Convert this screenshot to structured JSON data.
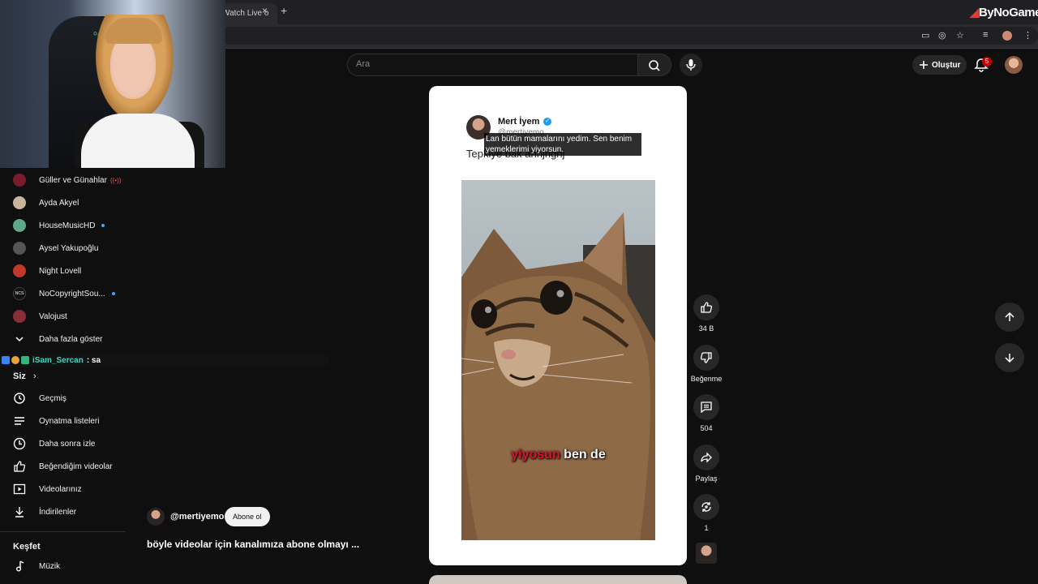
{
  "browser": {
    "tab_title": "Watch Live o",
    "brand": "ByNoGame",
    "tab_close": "×",
    "new_tab": "+"
  },
  "header": {
    "search_placeholder": "Ara",
    "create_label": "Oluştur",
    "notification_count": "5"
  },
  "sidebar": {
    "subscriptions": [
      {
        "name": "Güller ve Günahlar",
        "live": true,
        "color": "#7a1c2c"
      },
      {
        "name": "Ayda Akyel",
        "live": false,
        "color": "#c9b59a"
      },
      {
        "name": "HouseMusicHD",
        "live": true,
        "color": "#5fa88a"
      },
      {
        "name": "Aysel Yakupoğlu",
        "live": false,
        "color": "#555555"
      },
      {
        "name": "Night Lovell",
        "live": false,
        "color": "#c0392b"
      },
      {
        "name": "NoCopyrightSou...",
        "live": true,
        "color": "#111111"
      },
      {
        "name": "Valojust",
        "live": false,
        "color": "#8a2d35"
      }
    ],
    "show_more": "Daha fazla göster",
    "you_heading": "Siz",
    "you_items": [
      "Geçmiş",
      "Oynatma listeleri",
      "Daha sonra izle",
      "Beğendiğim videolar",
      "Videolarınız",
      "İndirilenler"
    ],
    "explore_heading": "Keşfet",
    "explore_items": [
      "Müzik"
    ]
  },
  "chat": {
    "user": "iSam_Sercan",
    "message": ": sa"
  },
  "short": {
    "tweet_author": "Mert İyem",
    "tweet_handle": "@mertiyemo",
    "tweet_text": "Tepkiye bak ahhjhghj",
    "caption": "Lan bütün mamalarını yedim. Sen benim yemeklerimi yiyorsun.",
    "subtitle_highlight": "yiyosun",
    "subtitle_rest": " ben de",
    "likes": "34 B",
    "dislike_label": "Beğenme",
    "comments": "504",
    "share_label": "Paylaş",
    "remix_count": "1",
    "channel": "@mertiyemo",
    "subscribe_label": "Abone ol",
    "title": "böyle videolar için kanalımıza abone olmayı ..."
  }
}
